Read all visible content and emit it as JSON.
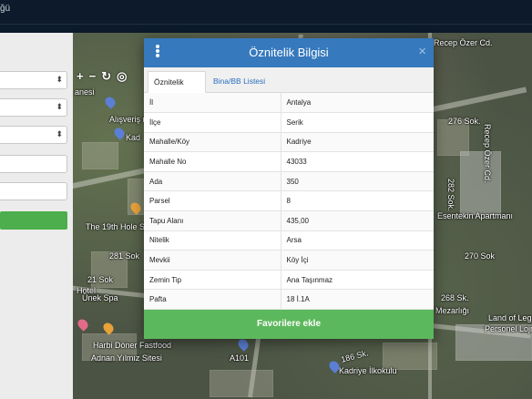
{
  "topbar": {
    "brand": "ğü"
  },
  "map_tools": {
    "zoom_in": "+",
    "zoom_out": "−",
    "refresh": "↻",
    "locate": "◎"
  },
  "map_labels": [
    "Recep Özer Cd.",
    "anesi",
    "Alışveriş merkezi",
    "Kad",
    "276 Sok.",
    "Recep Özer Cd.",
    "282 Sok.",
    "Esentekin Apartmanı",
    "The 19th Hole Sp",
    "270 Sok",
    "281 Sok",
    "21 Sok",
    "Hotel",
    "Ünek Spa",
    "268 Sk.",
    "Mezarlığı",
    "Land of Leg",
    "Personel Lojm",
    "Harbi Döner Fastfood",
    "Adnan Yılmız Sitesi",
    "186 Sk.",
    "Kadriye İlkokulu",
    "A101"
  ],
  "modal": {
    "title": "Öznitelik Bilgisi",
    "close": "×",
    "tabs": [
      "Öznitelik Bilgisi",
      "Bina/BB Listesi"
    ],
    "attributes": [
      {
        "key": "İl",
        "value": "Antalya"
      },
      {
        "key": "İlçe",
        "value": "Serik"
      },
      {
        "key": "Mahalle/Köy",
        "value": "Kadriye"
      },
      {
        "key": "Mahalle No",
        "value": "43033"
      },
      {
        "key": "Ada",
        "value": "350"
      },
      {
        "key": "Parsel",
        "value": "8"
      },
      {
        "key": "Tapu Alanı",
        "value": "435,00"
      },
      {
        "key": "Nitelik",
        "value": "Arsa"
      },
      {
        "key": "Mevkii",
        "value": "Köy İçi"
      },
      {
        "key": "Zemin Tip",
        "value": "Ana Taşınmaz"
      },
      {
        "key": "Pafta",
        "value": "18 İ.1A"
      }
    ],
    "favorite_button": "Favorilere ekle"
  },
  "colors": {
    "header": "#3679bd",
    "favorite": "#5cb85c",
    "topbar": "#0c1a2b"
  }
}
